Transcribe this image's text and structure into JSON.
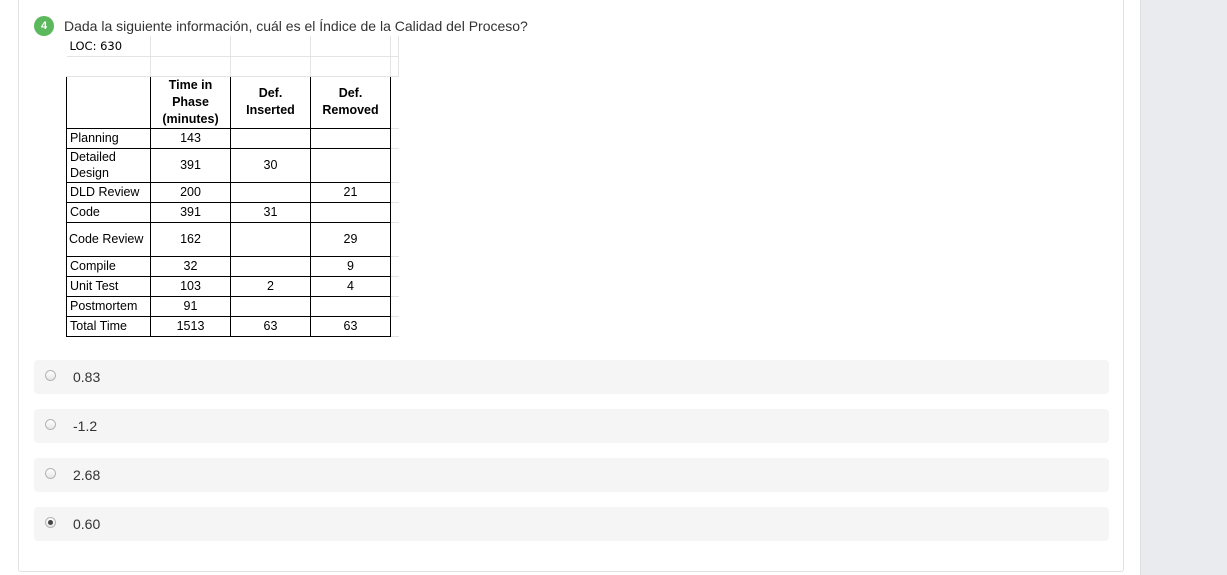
{
  "question": {
    "number": "4",
    "text": "Dada la siguiente información, cuál es el Índice de la Calidad del Proceso?"
  },
  "table": {
    "loc_label": "LOC: 630",
    "headers": [
      "",
      "Time in Phase (minutes)",
      "Def. Inserted",
      "Def. Removed"
    ],
    "rows": [
      {
        "phase": "Planning",
        "time": "143",
        "inserted": "",
        "removed": ""
      },
      {
        "phase": "Detailed Design",
        "time": "391",
        "inserted": "30",
        "removed": ""
      },
      {
        "phase": "DLD Review",
        "time": "200",
        "inserted": "",
        "removed": "21"
      },
      {
        "phase": "Code",
        "time": "391",
        "inserted": "31",
        "removed": ""
      },
      {
        "phase": "Code Review",
        "time": "162",
        "inserted": "",
        "removed": "29"
      },
      {
        "phase": "Compile",
        "time": "32",
        "inserted": "",
        "removed": "9"
      },
      {
        "phase": "Unit Test",
        "time": "103",
        "inserted": "2",
        "removed": "4"
      },
      {
        "phase": "Postmortem",
        "time": "91",
        "inserted": "",
        "removed": ""
      },
      {
        "phase": "Total Time",
        "time": "1513",
        "inserted": "63",
        "removed": "63"
      }
    ]
  },
  "options": [
    {
      "label": "0.83",
      "selected": false
    },
    {
      "label": "-1.2",
      "selected": false
    },
    {
      "label": "2.68",
      "selected": false
    },
    {
      "label": "0.60",
      "selected": true
    }
  ],
  "colors": {
    "badge": "#5cb85c",
    "option_bg": "#f5f5f5",
    "side_panel": "#e9ebee"
  }
}
